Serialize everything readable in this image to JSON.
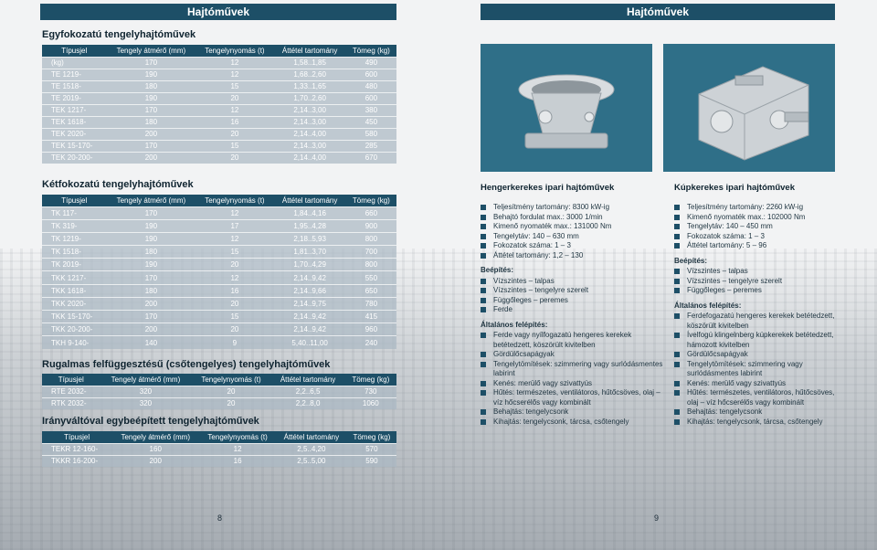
{
  "left": {
    "header": "Hajtóművek",
    "page_number": "8",
    "sections": [
      {
        "title": "Egyfokozatú tengelyhajtóművek",
        "columns": [
          "Típusjel",
          "Tengely átmérő (mm)",
          "Tengelynyomás (t)",
          "Áttétel tartomány",
          "Tömeg (kg)"
        ],
        "rows": [
          [
            "(kg)",
            "170",
            "12",
            "1,58..1,85",
            "490"
          ],
          [
            "TE 1219-",
            "190",
            "12",
            "1,68..2,60",
            "600"
          ],
          [
            "TE 1518-",
            "180",
            "15",
            "1,33..1,65",
            "480"
          ],
          [
            "TE 2019-",
            "190",
            "20",
            "1,70..2,60",
            "600"
          ],
          [
            "TEK 1217-",
            "170",
            "12",
            "2,14..3,00",
            "380"
          ],
          [
            "TEK 1618-",
            "180",
            "16",
            "2,14..3,00",
            "450"
          ],
          [
            "TEK 2020-",
            "200",
            "20",
            "2,14..4,00",
            "580"
          ],
          [
            "TEK 15-170-",
            "170",
            "15",
            "2,14..3,00",
            "285"
          ],
          [
            "TEK 20-200-",
            "200",
            "20",
            "2,14..4,00",
            "670"
          ]
        ]
      },
      {
        "title": "Kétfokozatú tengelyhajtóművek",
        "columns": [
          "Típusjel",
          "Tengely átmérő (mm)",
          "Tengelynyomás (t)",
          "Áttétel tartomány",
          "Tömeg (kg)"
        ],
        "rows": [
          [
            "TK 117-",
            "170",
            "12",
            "1,84..4,16",
            "660"
          ],
          [
            "TK 319-",
            "190",
            "17",
            "1,95..4,28",
            "900"
          ],
          [
            "TK 1219-",
            "190",
            "12",
            "2,18..5,93",
            "800"
          ],
          [
            "TK 1518-",
            "180",
            "15",
            "1,81..3,70",
            "700"
          ],
          [
            "TK 2019-",
            "190",
            "20",
            "1,70..4,29",
            "800"
          ],
          [
            "TKK 1217-",
            "170",
            "12",
            "2,14..9,42",
            "550"
          ],
          [
            "TKK 1618-",
            "180",
            "16",
            "2,14..9,66",
            "650"
          ],
          [
            "TKK 2020-",
            "200",
            "20",
            "2,14..9,75",
            "780"
          ],
          [
            "TKK 15-170-",
            "170",
            "15",
            "2,14..9,42",
            "415"
          ],
          [
            "TKK 20-200-",
            "200",
            "20",
            "2,14..9,42",
            "960"
          ],
          [
            "TKH 9-140-",
            "140",
            "9",
            "5,40..11,00",
            "240"
          ]
        ]
      },
      {
        "title": "Rugalmas felfüggesztésű (csőtengelyes) tengelyhajtóművek",
        "columns": [
          "Típusjel",
          "Tengely átmérő (mm)",
          "Tengelynyomás (t)",
          "Áttétel tartomány",
          "Tömeg (kg)"
        ],
        "rows": [
          [
            "RTE 2032-",
            "320",
            "20",
            "2,2..6,5",
            "730"
          ],
          [
            "RTK 2032-",
            "320",
            "20",
            "2,2..8,0",
            "1060"
          ]
        ]
      },
      {
        "title": "Irányváltóval egybeépített tengelyhajtóművek",
        "columns": [
          "Típusjel",
          "Tengely átmérő (mm)",
          "Tengelynyomás (t)",
          "Áttétel tartomány",
          "Tömeg (kg)"
        ],
        "rows": [
          [
            "TEKR 12-160-",
            "160",
            "12",
            "2,5..4,20",
            "570"
          ],
          [
            "TKKR 16-200-",
            "200",
            "16",
            "2,5..5,00",
            "590"
          ]
        ]
      }
    ]
  },
  "right": {
    "header": "Hajtóművek",
    "page_number": "9",
    "cylindrical": {
      "title": "Hengerkerekes ipari hajtóművek",
      "specs": [
        "Teljesítmény tartomány: 8300 kW-ig",
        "Behajtó fordulat max.: 3000 1/min",
        "Kimenő nyomaték max.: 131000 Nm",
        "Tengelytáv: 140 – 630 mm",
        "Fokozatok száma: 1 – 3",
        "Áttétel tartomány: 1,2 – 130"
      ],
      "mount_title": "Beépítés:",
      "mount": [
        "Vízszintes – talpas",
        "Vízszintes – tengelyre szerelt",
        "Függőleges – peremes",
        "Ferde"
      ],
      "general_title": "Általános felépítés:",
      "general": [
        "Ferde vagy nyílfogazatú hengeres kerekek betétedzett, köszörült kivitelben",
        "Gördülőcsapágyak",
        "Tengelytömítések: szimmering vagy surlódásmentes labirint",
        "Kenés: merülő vagy szivattyús",
        "Hűtés: természetes, ventilátoros, hűtőcsöves, olaj – víz hőcserélős vagy kombinált",
        "Behajtás: tengelycsonk",
        "Kihajtás: tengelycsonk, tárcsa, csőtengely"
      ]
    },
    "bevel": {
      "title": "Kúpkerekes ipari hajtóművek",
      "specs": [
        "Teljesítmény tartomány: 2260 kW-ig",
        "Kimenő nyomaték max.: 102000 Nm",
        "Tengelytáv: 140 – 450 mm",
        "Fokozatok száma: 1 – 3",
        "Áttétel tartomány: 5 – 96"
      ],
      "mount_title": "Beépítés:",
      "mount": [
        "Vízszintes – talpas",
        "Vízszintes – tengelyre szerelt",
        "Függőleges – peremes"
      ],
      "general_title": "Általános felépítés:",
      "general": [
        "Ferdefogazatú hengeres kerekek betétedzett, köszörült kivitelben",
        "Ívelfogú klingelnberg kúpkerekek betétedzett, hámozott kivitelben",
        "Gördülőcsapágyak",
        "Tengelytömítések: szimmering vagy surlódásmentes labirint",
        "Kenés: merülő vagy szivattyús",
        "Hűtés: természetes, ventilátoros, hűtőcsöves, olaj – víz hőcserélős vagy kombinált",
        "Behajtás: tengelycsonk",
        "Kihajtás: tengelycsonk, tárcsa, csőtengely"
      ]
    }
  }
}
